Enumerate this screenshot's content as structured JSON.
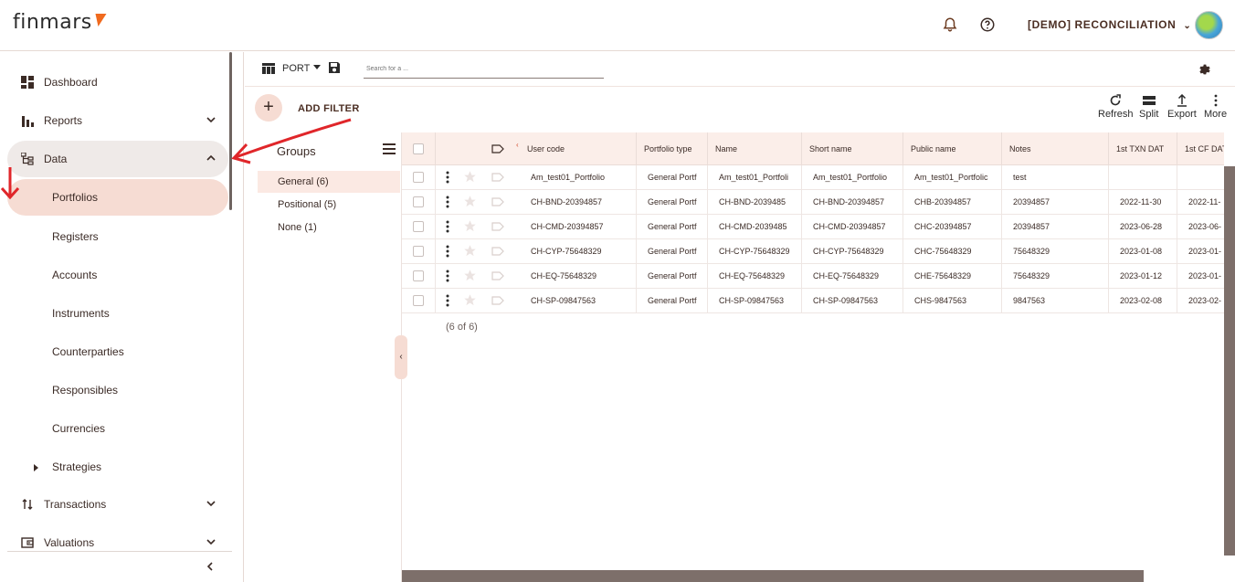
{
  "app": {
    "logo_text": "finmars",
    "workspace": "[DEMO] RECONCILIATION"
  },
  "sidebar": {
    "items": [
      {
        "label": "Dashboard",
        "icon": "dashboard-icon"
      },
      {
        "label": "Reports",
        "icon": "bar-chart-icon"
      },
      {
        "label": "Data",
        "icon": "data-tree-icon"
      },
      {
        "label": "Transactions",
        "icon": "transactions-icon"
      },
      {
        "label": "Valuations",
        "icon": "wallet-icon"
      }
    ],
    "data_children": [
      "Portfolios",
      "Registers",
      "Accounts",
      "Instruments",
      "Counterparties",
      "Responsibles",
      "Currencies",
      "Strategies"
    ]
  },
  "toolbar": {
    "layout_name": "PORT",
    "search_placeholder": "Search for a ...",
    "add_filter_label": "ADD FILTER",
    "actions": [
      "Refresh",
      "Split",
      "Export",
      "More"
    ]
  },
  "groups": {
    "title": "Groups",
    "items": [
      "General (6)",
      "Positional (5)",
      "None (1)"
    ],
    "selected": "General (6)"
  },
  "table": {
    "columns": [
      "User code",
      "Portfolio type",
      "Name",
      "Short name",
      "Public name",
      "Notes",
      "1st TXN DAT",
      "1st CF DAT"
    ],
    "rows": [
      [
        "Am_test01_Portfolio",
        "General Portf",
        "Am_test01_Portfoli",
        "Am_test01_Portfolio",
        "Am_test01_Portfolic",
        "test",
        "",
        ""
      ],
      [
        "CH-BND-20394857",
        "General Portf",
        "CH-BND-2039485",
        "CH-BND-20394857",
        "CHB-20394857",
        "20394857",
        "2022-11-30",
        "2022-11-"
      ],
      [
        "CH-CMD-20394857",
        "General Portf",
        "CH-CMD-2039485",
        "CH-CMD-20394857",
        "CHC-20394857",
        "20394857",
        "2023-06-28",
        "2023-06-"
      ],
      [
        "CH-CYP-75648329",
        "General Portf",
        "CH-CYP-75648329",
        "CH-CYP-75648329",
        "CHC-75648329",
        "75648329",
        "2023-01-08",
        "2023-01-"
      ],
      [
        "CH-EQ-75648329",
        "General Portf",
        "CH-EQ-75648329",
        "CH-EQ-75648329",
        "CHE-75648329",
        "75648329",
        "2023-01-12",
        "2023-01-"
      ],
      [
        "CH-SP-09847563",
        "General Portf",
        "CH-SP-09847563",
        "CH-SP-09847563",
        "CHS-9847563",
        "9847563",
        "2023-02-08",
        "2023-02-"
      ]
    ],
    "count_text": "(6 of 6)"
  },
  "colors": {
    "accent": "#f06a1e",
    "active_bg": "#f6dcd3",
    "header_bg": "#fbeee9",
    "annotation": "#e0262a"
  }
}
